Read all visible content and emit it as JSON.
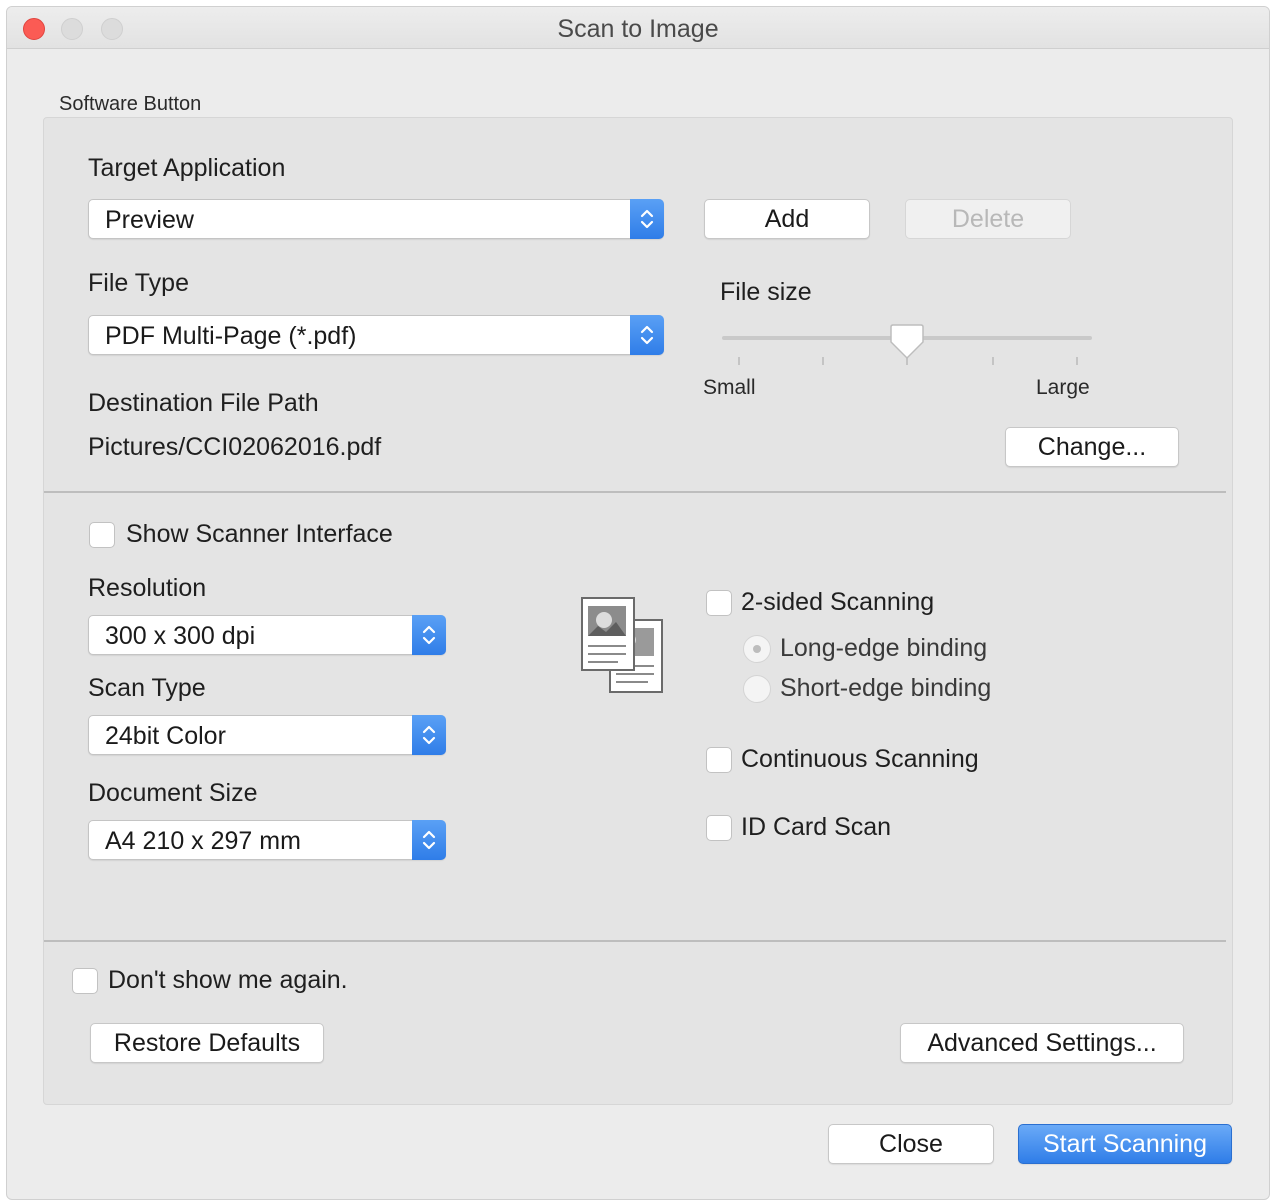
{
  "window": {
    "title": "Scan to Image"
  },
  "group": {
    "label": "Software Button"
  },
  "target_application": {
    "label": "Target Application",
    "value": "Preview",
    "add_label": "Add",
    "delete_label": "Delete"
  },
  "file_type": {
    "label": "File Type",
    "value": "PDF Multi-Page (*.pdf)"
  },
  "file_size": {
    "label": "File size",
    "min_label": "Small",
    "max_label": "Large",
    "level": 0.5
  },
  "destination": {
    "label": "Destination File Path",
    "path": "Pictures/CCI02062016.pdf",
    "change_label": "Change..."
  },
  "scanner_interface": {
    "label": "Show Scanner Interface",
    "checked": false
  },
  "resolution": {
    "label": "Resolution",
    "value": "300 x 300 dpi"
  },
  "scan_type": {
    "label": "Scan Type",
    "value": "24bit Color"
  },
  "document_size": {
    "label": "Document Size",
    "value": "A4 210 x 297 mm"
  },
  "two_sided": {
    "label": "2-sided Scanning",
    "checked": false,
    "long_edge": "Long-edge binding",
    "short_edge": "Short-edge binding",
    "selected": "Long-edge binding"
  },
  "continuous": {
    "label": "Continuous Scanning",
    "checked": false
  },
  "id_card": {
    "label": "ID Card Scan",
    "checked": false
  },
  "dont_show": {
    "label": "Don't show me again.",
    "checked": false
  },
  "buttons": {
    "restore_defaults": "Restore Defaults",
    "advanced_settings": "Advanced Settings...",
    "close": "Close",
    "start_scanning": "Start Scanning"
  },
  "colors": {
    "accent": "#2f7de8",
    "close_button": "#fb5b54"
  },
  "icons": {
    "stepper": "up-down-chevron-icon",
    "document": "two-sided-document-icon"
  }
}
